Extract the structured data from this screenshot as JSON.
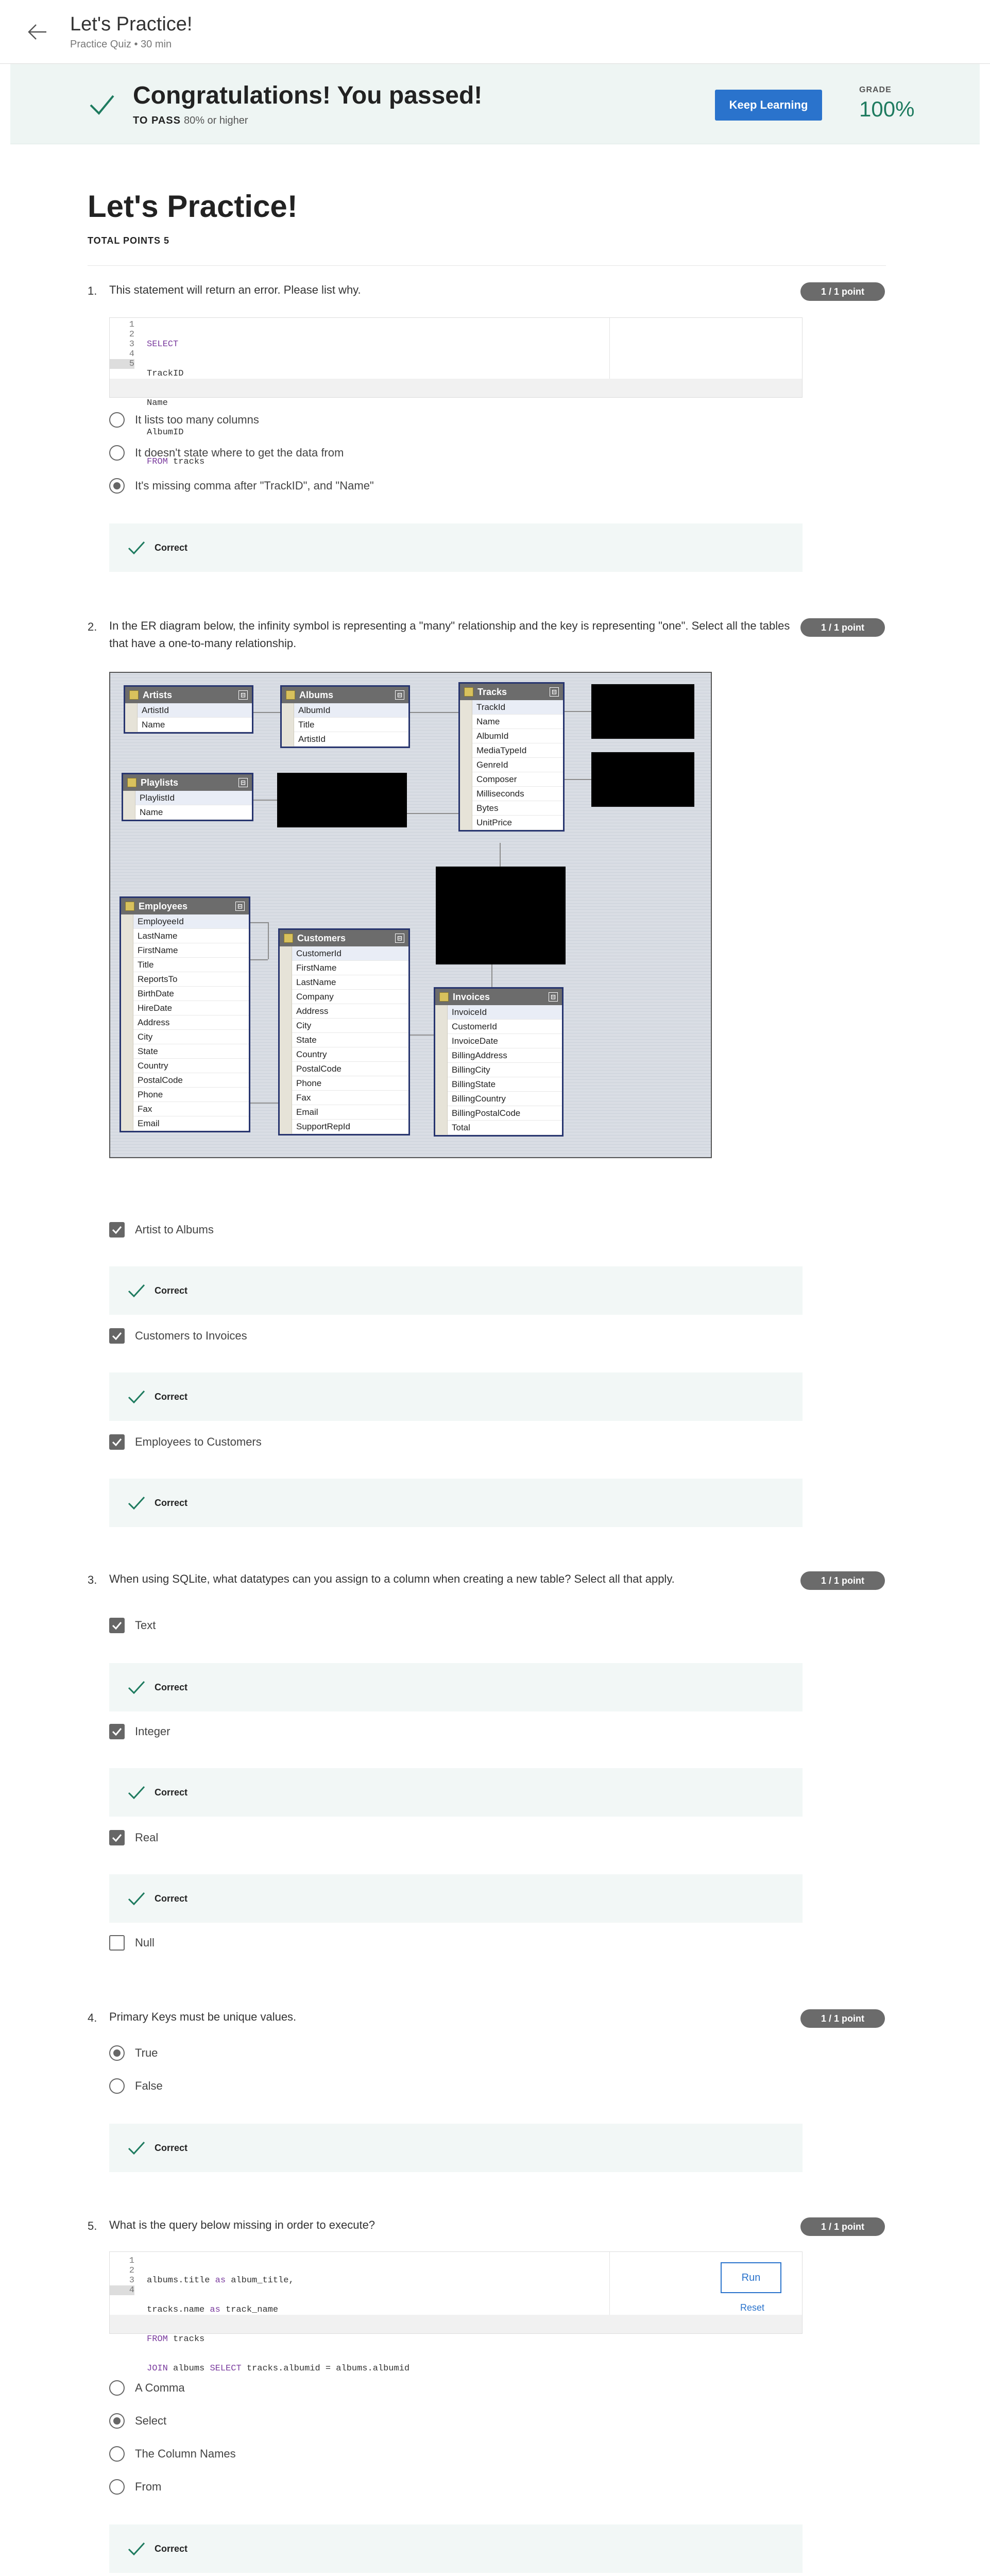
{
  "header": {
    "title": "Let's Practice!",
    "subtitle": "Practice Quiz • 30 min"
  },
  "banner": {
    "message": "Congratulations! You passed!",
    "to_pass_label": "TO PASS",
    "to_pass_value": "80% or higher",
    "button": "Keep Learning",
    "grade_label": "GRADE",
    "grade_value": "100%"
  },
  "page": {
    "title": "Let's Practice!",
    "total_points": "TOTAL POINTS 5"
  },
  "colors": {
    "accent": "#2a73cc",
    "success": "#1e7b5f",
    "badge": "#6b6b6b",
    "feedback_bg": "#f2f7f6"
  },
  "feedback": "Correct",
  "q1": {
    "num": "1.",
    "text": "This statement will return an error. Please list why.",
    "points": "1 / 1 point",
    "code_lines": [
      "1",
      "2",
      "3",
      "4",
      "5"
    ],
    "code": [
      {
        "kw": "SELECT",
        "rest": ""
      },
      {
        "kw": "",
        "rest": "TrackID"
      },
      {
        "kw": "",
        "rest": "Name"
      },
      {
        "kw": "",
        "rest": "AlbumID"
      },
      {
        "kw": "FROM",
        "rest": " tracks"
      }
    ],
    "options": [
      "It lists too many columns",
      "It doesn't state where to get the data from",
      "It's missing comma after \"TrackID\", and \"Name\""
    ],
    "selected": 2
  },
  "q2": {
    "num": "2.",
    "text": "In the ER diagram below, the infinity symbol is representing a \"many\" relationship and the key is representing \"one\". Select all the tables that have a one-to-many relationship.",
    "points": "1 / 1 point",
    "options": [
      "Artist to Albums",
      "Customers to Invoices",
      "Employees to Customers"
    ],
    "diagram": {
      "artists": {
        "name": "Artists",
        "cols": [
          "ArtistId",
          "Name"
        ]
      },
      "albums": {
        "name": "Albums",
        "cols": [
          "AlbumId",
          "Title",
          "ArtistId"
        ]
      },
      "tracks": {
        "name": "Tracks",
        "cols": [
          "TrackId",
          "Name",
          "AlbumId",
          "MediaTypeId",
          "GenreId",
          "Composer",
          "Milliseconds",
          "Bytes",
          "UnitPrice"
        ]
      },
      "playlists": {
        "name": "Playlists",
        "cols": [
          "PlaylistId",
          "Name"
        ]
      },
      "employees": {
        "name": "Employees",
        "cols": [
          "EmployeeId",
          "LastName",
          "FirstName",
          "Title",
          "ReportsTo",
          "BirthDate",
          "HireDate",
          "Address",
          "City",
          "State",
          "Country",
          "PostalCode",
          "Phone",
          "Fax",
          "Email"
        ]
      },
      "customers": {
        "name": "Customers",
        "cols": [
          "CustomerId",
          "FirstName",
          "LastName",
          "Company",
          "Address",
          "City",
          "State",
          "Country",
          "PostalCode",
          "Phone",
          "Fax",
          "Email",
          "SupportRepId"
        ]
      },
      "invoices": {
        "name": "Invoices",
        "cols": [
          "InvoiceId",
          "CustomerId",
          "InvoiceDate",
          "BillingAddress",
          "BillingCity",
          "BillingState",
          "BillingCountry",
          "BillingPostalCode",
          "Total"
        ]
      }
    }
  },
  "q3": {
    "num": "3.",
    "text": "When using SQLite, what datatypes can you assign to a column when creating a new table? Select all that apply.",
    "points": "1 / 1 point",
    "options": [
      "Text",
      "Integer",
      "Real",
      "Null"
    ]
  },
  "q4": {
    "num": "4.",
    "text": "Primary Keys must be unique values.",
    "points": "1 / 1 point",
    "options": [
      "True",
      "False"
    ]
  },
  "q5": {
    "num": "5.",
    "text": "What is the query below missing in order to execute?",
    "points": "1 / 1 point",
    "code_lines": [
      "1",
      "2",
      "3",
      "4"
    ],
    "code": [
      {
        "pre": "albums.title ",
        "kw": "as",
        "post": " album_title,"
      },
      {
        "pre": "tracks.name ",
        "kw": "as",
        "post": " track_name"
      },
      {
        "pre": "",
        "kw": "FROM",
        "post": " tracks"
      },
      {
        "pre": "",
        "kw": "JOIN",
        "post": " albums ",
        "kw2": "SELECT",
        "post2": " tracks.albumid = albums.albumid"
      }
    ],
    "run": "Run",
    "reset": "Reset",
    "options": [
      "A Comma",
      "Select",
      "The Column Names",
      "From"
    ]
  }
}
